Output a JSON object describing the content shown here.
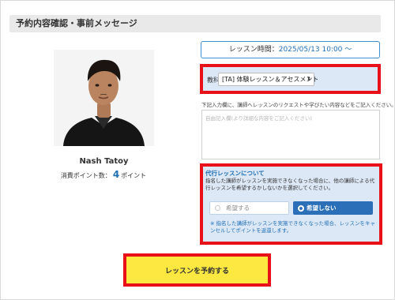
{
  "section": {
    "title": "予約内容確認・事前メッセージ"
  },
  "lesson_time": {
    "label": "レッスン時間：",
    "value": "2025/05/13 10:00 〜"
  },
  "teacher": {
    "name": "Nash Tatoy",
    "points_label": "消費ポイント数：",
    "points_value": "4",
    "points_unit": "ポイント"
  },
  "subject": {
    "label": "教科",
    "selected": "[TA] 体験レッスン＆アセスメント",
    "arrow": "⌃⌄"
  },
  "message": {
    "hint": "下記入力欄に、講師へレッスンのリクエストや学びたい内容などをご記入ください。",
    "placeholder": "自由記入欄(より詳細な内容をご記入ください)"
  },
  "substitute": {
    "title": "代行レッスンについて",
    "description": "指名した講師がレッスンを実施できなくなった場合に、他の講師による代行レッスンを希望するかしないかを選択してください。",
    "option_yes": "希望する",
    "option_no": "希望しない",
    "selected": "希望しない",
    "note": "※ 指名した講師がレッスンを実施できなくなった場合、レッスンをキャンセルしてポイントを返還します。"
  },
  "reserve_button": {
    "label": "レッスンを予約する"
  },
  "colors": {
    "highlight_red": "#e8111a",
    "accent_blue": "#2a6fb8",
    "panel_blue": "#dde8f6",
    "cta_yellow": "#fce840"
  }
}
